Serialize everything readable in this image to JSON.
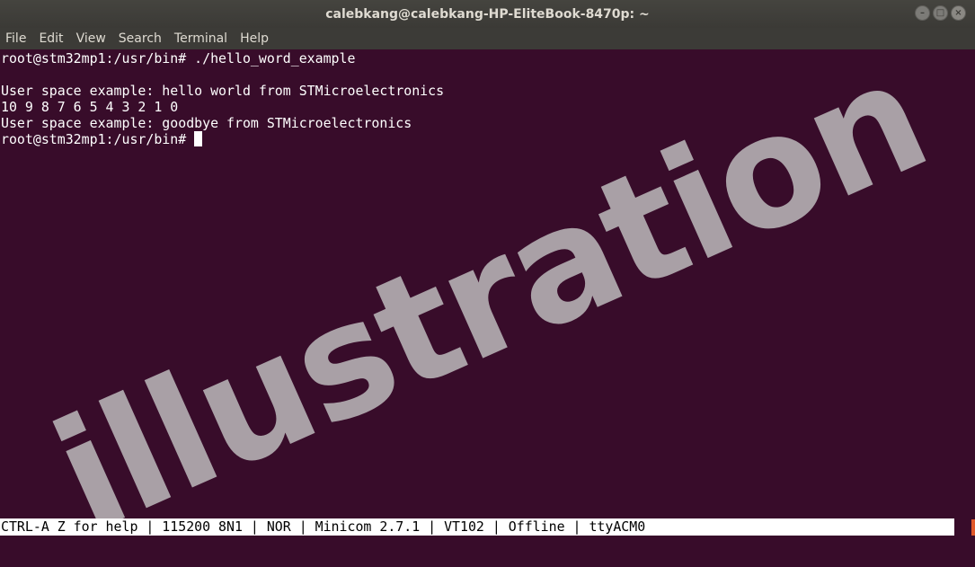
{
  "window": {
    "title": "calebkang@calebkang-HP-EliteBook-8470p: ~",
    "controls": [
      "minimize-icon",
      "maximize-icon",
      "close-icon"
    ]
  },
  "menubar": {
    "items": [
      "File",
      "Edit",
      "View",
      "Search",
      "Terminal",
      "Help"
    ]
  },
  "terminal": {
    "lines": [
      "root@stm32mp1:/usr/bin# ./hello_word_example",
      "",
      "User space example: hello world from STMicroelectronics",
      "10 9 8 7 6 5 4 3 2 1 0",
      "User space example: goodbye from STMicroelectronics",
      "root@stm32mp1:/usr/bin# "
    ]
  },
  "watermark": "illustration",
  "statusbar": {
    "text": "CTRL-A Z for help | 115200 8N1 | NOR | Minicom 2.7.1 | VT102 | Offline | ttyACM0"
  },
  "colors": {
    "background": "#380c2a",
    "titlebar": "#3c3b37",
    "text": "#ffffff",
    "watermark": "#a9a0a6"
  }
}
